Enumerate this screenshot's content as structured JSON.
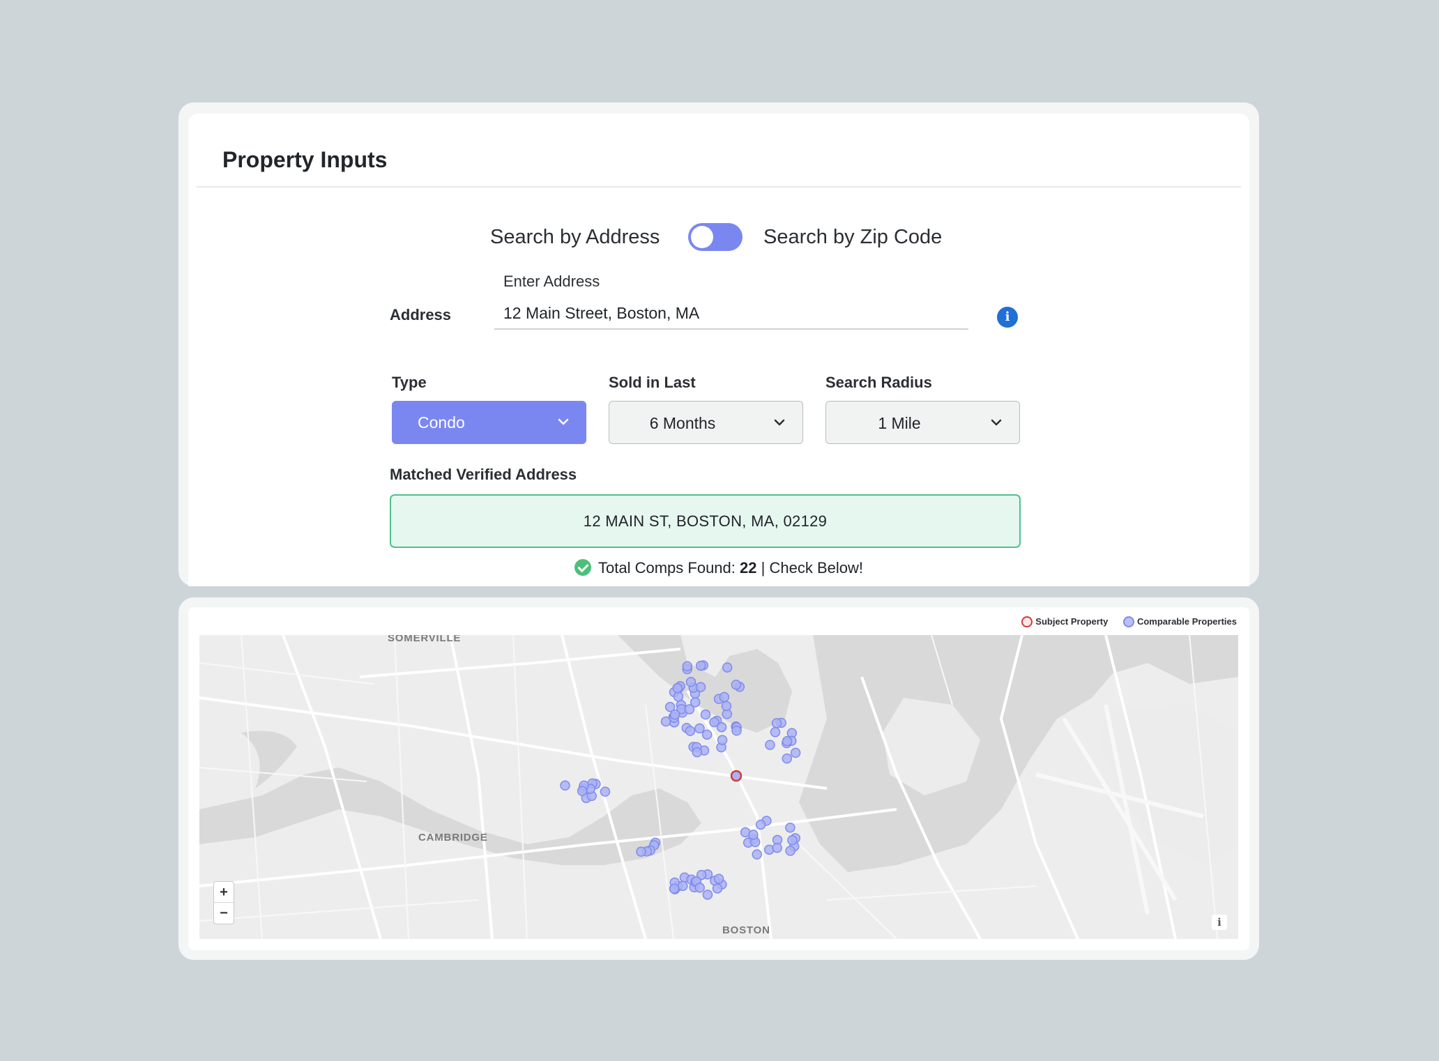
{
  "panel": {
    "title": "Property Inputs"
  },
  "search_mode": {
    "left_label": "Search by Address",
    "right_label": "Search by Zip Code"
  },
  "address": {
    "row_label": "Address",
    "field_label": "Enter Address",
    "value": "12 Main Street, Boston, MA",
    "info_icon": "info-icon"
  },
  "filters": {
    "type_label": "Type",
    "type_value": "Condo",
    "sold_label": "Sold in Last",
    "sold_value": "6 Months",
    "radius_label": "Search Radius",
    "radius_value": "1 Mile"
  },
  "matched": {
    "label": "Matched Verified Address",
    "value": "12 MAIN ST, BOSTON, MA, 02129"
  },
  "comps": {
    "prefix": "Total Comps Found:",
    "count": "22",
    "separator": "|",
    "suffix": "Check Below!"
  },
  "legend": {
    "subject": "Subject Property",
    "comparable": "Comparable Properties"
  },
  "map": {
    "labels": {
      "somerville": "SOMERVILLE",
      "cambridge": "CAMBRIDGE",
      "boston": "BOSTON"
    },
    "zoom_in": "+",
    "zoom_out": "−",
    "info": "i"
  },
  "colors": {
    "accent": "#7b87f0",
    "verified_bg": "#e6f7f0",
    "verified_border": "#4fc08d",
    "subject_marker": "#d23a3a",
    "comp_marker": "#7f8bea"
  }
}
